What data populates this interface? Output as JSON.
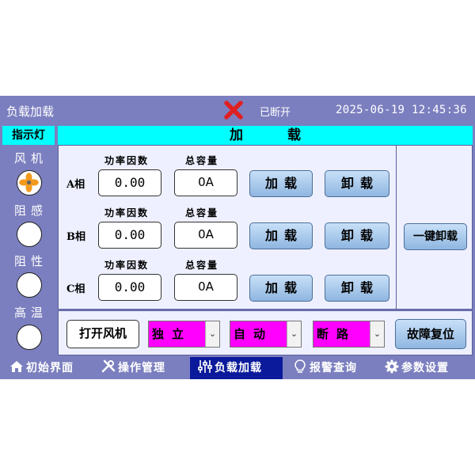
{
  "header": {
    "title": "负载加载",
    "connection_status": "已断开",
    "datetime": "2025-06-19 12:45:36"
  },
  "indicators": {
    "title": "指示灯",
    "items": [
      {
        "label": "风机",
        "icon": "fan-icon"
      },
      {
        "label": "阻感"
      },
      {
        "label": "阻性"
      },
      {
        "label": "高温"
      }
    ]
  },
  "section": {
    "title": "加载"
  },
  "columns": {
    "power_factor": "功率因数",
    "total_capacity": "总容量"
  },
  "phases": [
    {
      "name": "A相",
      "power_factor": "0.00",
      "capacity": "0A"
    },
    {
      "name": "B相",
      "power_factor": "0.00",
      "capacity": "0A"
    },
    {
      "name": "C相",
      "power_factor": "0.00",
      "capacity": "0A"
    }
  ],
  "buttons": {
    "load": "加载",
    "unload": "卸载",
    "one_key_unload": "一键卸载",
    "open_fan": "打开风机",
    "fault_reset": "故障复位"
  },
  "selects": {
    "mode": "独立",
    "control": "自动",
    "breaker": "断路"
  },
  "nav": {
    "home": "初始界面",
    "operation": "操作管理",
    "load": "负载加载",
    "alarm": "报警查询",
    "params": "参数设置"
  },
  "colors": {
    "frame": "#7b7fbf",
    "title_bar": "#00ffff",
    "select_bg": "#ff00ff",
    "nav_active": "#0a1a9a",
    "disconnected": "#e02020"
  }
}
